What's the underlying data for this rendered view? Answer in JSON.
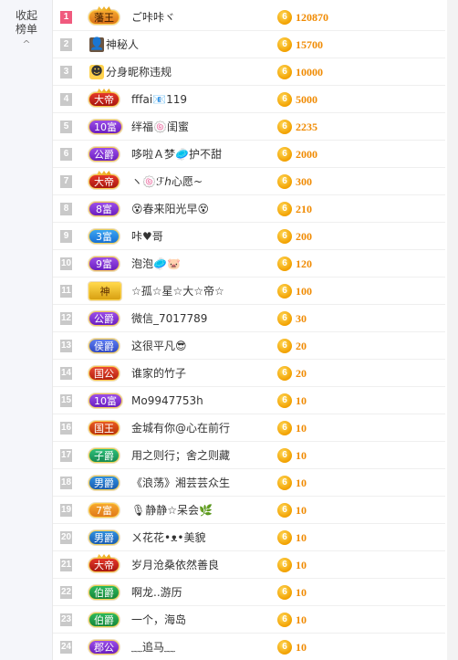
{
  "sidebar": {
    "collapse_line1": "收起",
    "collapse_line2": "榜单",
    "chevron": "^"
  },
  "rows": [
    {
      "rank": "1",
      "badge": "藩王",
      "badge_class": "b-king-orange crown",
      "name": "ご咔咔ヾ",
      "coin": "6",
      "amount": "120870"
    },
    {
      "rank": "2",
      "avatar": "mystery-person-icon",
      "avatar_glyph": "👤",
      "name": "神秘人",
      "coin": "6",
      "amount": "15700"
    },
    {
      "rank": "3",
      "avatar": "face-icon",
      "avatar_glyph": "☻",
      "name": "分身昵称违规",
      "coin": "6",
      "amount": "10000"
    },
    {
      "rank": "4",
      "badge": "大帝",
      "badge_class": "b-dadi crown",
      "name": "fffai📧119",
      "coin": "6",
      "amount": "5000"
    },
    {
      "rank": "5",
      "badge": "10富",
      "badge_class": "b-purple",
      "name": "绊福🍥闺蜜",
      "coin": "6",
      "amount": "2235"
    },
    {
      "rank": "6",
      "badge": "公爵",
      "badge_class": "b-jungong",
      "name": "哆啦Ａ梦🥏护不甜",
      "coin": "6",
      "amount": "2000"
    },
    {
      "rank": "7",
      "badge": "大帝",
      "badge_class": "b-dadi crown",
      "name": "ヽ🍥ℱℎ心愿~",
      "coin": "6",
      "amount": "300"
    },
    {
      "rank": "8",
      "badge": "8富",
      "badge_class": "b-purple",
      "name": "😵春来阳光早😵",
      "coin": "6",
      "amount": "210"
    },
    {
      "rank": "9",
      "badge": "3富",
      "badge_class": "b-blue",
      "name": "咔♥哥",
      "coin": "6",
      "amount": "200"
    },
    {
      "rank": "10",
      "badge": "9富",
      "badge_class": "b-purple",
      "name": "泡泡🥏🐷",
      "coin": "6",
      "amount": "120"
    },
    {
      "rank": "11",
      "badge": "神",
      "badge_class": "b-god",
      "name": "☆孤☆星☆大☆帝☆",
      "coin": "6",
      "amount": "100"
    },
    {
      "rank": "12",
      "badge": "公爵",
      "badge_class": "b-jungong",
      "name": "微信_7017789",
      "coin": "6",
      "amount": "30"
    },
    {
      "rank": "13",
      "badge": "侯爵",
      "badge_class": "b-hou",
      "name": "这很平凡😎",
      "coin": "6",
      "amount": "20"
    },
    {
      "rank": "14",
      "badge": "国公",
      "badge_class": "b-guogong",
      "name": "谁家的竹子",
      "coin": "6",
      "amount": "20"
    },
    {
      "rank": "15",
      "badge": "10富",
      "badge_class": "b-purple",
      "name": "Mo9947753h",
      "coin": "6",
      "amount": "10"
    },
    {
      "rank": "16",
      "badge": "国王",
      "badge_class": "b-guowang",
      "name": "金城有你@心在前行",
      "coin": "6",
      "amount": "10"
    },
    {
      "rank": "17",
      "badge": "子爵",
      "badge_class": "b-zijue",
      "name": "用之则行；舍之则藏",
      "coin": "6",
      "amount": "10"
    },
    {
      "rank": "18",
      "badge": "男爵",
      "badge_class": "b-nanjue",
      "name": "《浪荡》湘芸芸众生",
      "coin": "6",
      "amount": "10"
    },
    {
      "rank": "19",
      "badge": "7富",
      "badge_class": "b-orange7",
      "name": "🎙静静☆呆会🌿",
      "coin": "6",
      "amount": "10"
    },
    {
      "rank": "20",
      "badge": "男爵",
      "badge_class": "b-nanjue",
      "name": "ㄨ花花•ᴥ•美貌",
      "coin": "6",
      "amount": "10"
    },
    {
      "rank": "21",
      "badge": "大帝",
      "badge_class": "b-dadi crown",
      "name": "岁月沧桑依然善良",
      "coin": "6",
      "amount": "10"
    },
    {
      "rank": "22",
      "badge": "伯爵",
      "badge_class": "b-bojue",
      "name": "啊龙..游历",
      "coin": "6",
      "amount": "10"
    },
    {
      "rank": "23",
      "badge": "伯爵",
      "badge_class": "b-bojue",
      "name": "一个，海岛",
      "coin": "6",
      "amount": "10"
    },
    {
      "rank": "24",
      "badge": "郡公",
      "badge_class": "b-jungong",
      "name": "﹏追马﹏",
      "coin": "6",
      "amount": "10"
    }
  ]
}
